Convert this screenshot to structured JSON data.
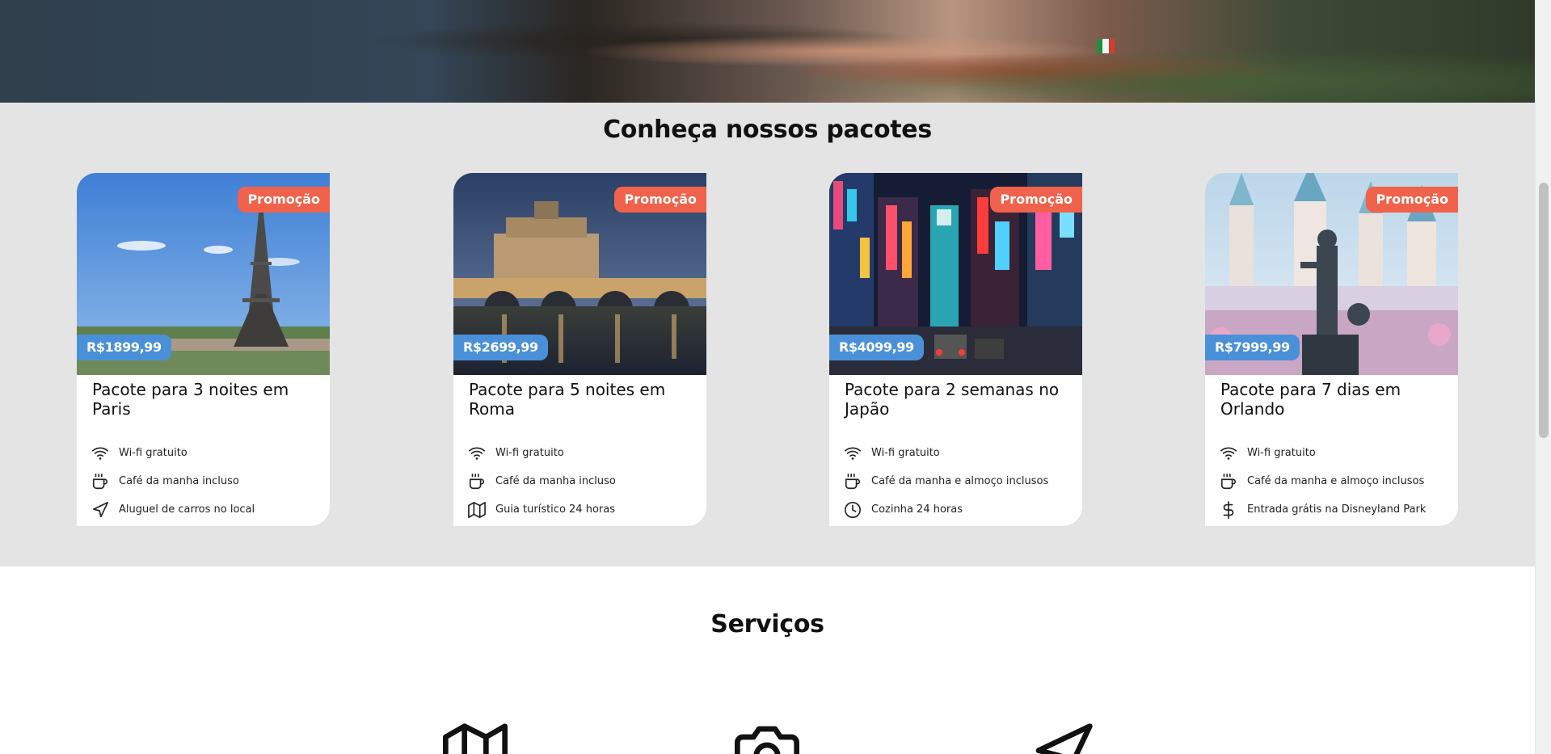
{
  "packages_section": {
    "title": "Conheça nossos pacotes",
    "cards": [
      {
        "badge": "Promoção",
        "price": "R$1899,99",
        "title": "Pacote para 3 noites em Paris",
        "features": [
          {
            "icon": "wifi-icon",
            "label": "Wi-fi gratuito"
          },
          {
            "icon": "coffee-icon",
            "label": "Café da manha incluso"
          },
          {
            "icon": "navigation-icon",
            "label": "Aluguel de carros no local"
          }
        ]
      },
      {
        "badge": "Promoção",
        "price": "R$2699,99",
        "title": "Pacote para 5 noites em Roma",
        "features": [
          {
            "icon": "wifi-icon",
            "label": "Wi-fi gratuito"
          },
          {
            "icon": "coffee-icon",
            "label": "Café da manha incluso"
          },
          {
            "icon": "map-icon",
            "label": "Guia turístico 24 horas"
          }
        ]
      },
      {
        "badge": "Promoção",
        "price": "R$4099,99",
        "title": "Pacote para 2 semanas no Japão",
        "features": [
          {
            "icon": "wifi-icon",
            "label": "Wi-fi gratuito"
          },
          {
            "icon": "coffee-icon",
            "label": "Café da manha e almoço inclusos"
          },
          {
            "icon": "clock-icon",
            "label": "Cozinha 24 horas"
          }
        ]
      },
      {
        "badge": "Promoção",
        "price": "R$7999,99",
        "title": "Pacote para 7 dias em Orlando",
        "features": [
          {
            "icon": "wifi-icon",
            "label": "Wi-fi gratuito"
          },
          {
            "icon": "coffee-icon",
            "label": "Café da manha e almoço inclusos"
          },
          {
            "icon": "dollar-icon",
            "label": "Entrada grátis na Disneyland Park"
          }
        ]
      }
    ]
  },
  "services_section": {
    "title": "Serviços",
    "icons": [
      "map-icon",
      "camera-icon",
      "send-icon"
    ]
  },
  "colors": {
    "promo_badge": "#f0624b",
    "price_badge": "#4a90d9",
    "section_background": "#e4e4e4"
  }
}
